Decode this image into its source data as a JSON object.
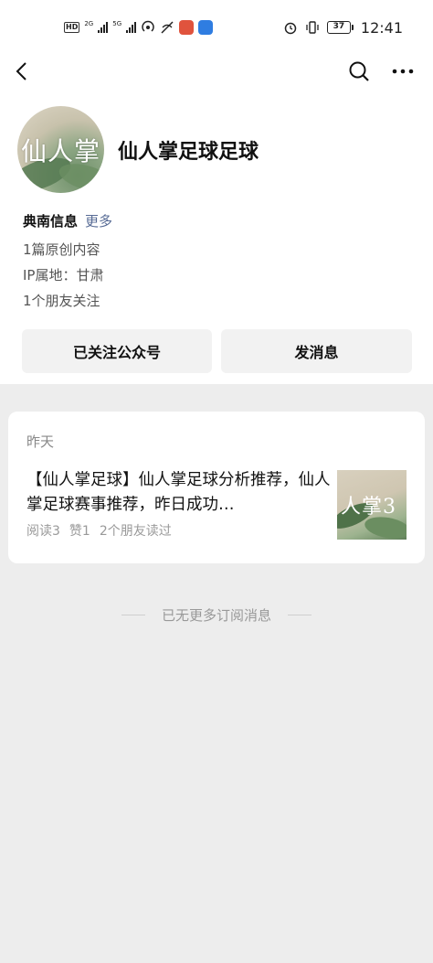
{
  "status_bar": {
    "network_chip": "HD",
    "network_2g": "2G",
    "network_5g": "5G",
    "battery": "37",
    "time": "12:41",
    "colors": {
      "app1": "#e0533d",
      "app2": "#2f7de1"
    }
  },
  "nav": {
    "back_icon": "chevron-left-icon",
    "search_icon": "search-icon",
    "more_icon": "more-icon"
  },
  "profile": {
    "avatar_text": "仙人掌",
    "name": "仙人掌足球足球",
    "company": "典南信息",
    "more_link": "更多",
    "original_count": "1篇原创内容",
    "ip_location": "IP属地：甘肃",
    "friends_following": "1个朋友关注"
  },
  "actions": {
    "followed_label": "已关注公众号",
    "message_label": "发消息"
  },
  "article": {
    "date": "昨天",
    "title": "【仙人掌足球】仙人掌足球分析推荐，仙人掌足球赛事推荐，昨日成功…",
    "reads": "阅读3",
    "likes": "赞1",
    "friends_read": "2个朋友读过",
    "thumb_text": "人掌3"
  },
  "footer": {
    "end_text": "已无更多订阅消息"
  },
  "colors": {
    "link": "#576b95",
    "background": "#ededed"
  }
}
